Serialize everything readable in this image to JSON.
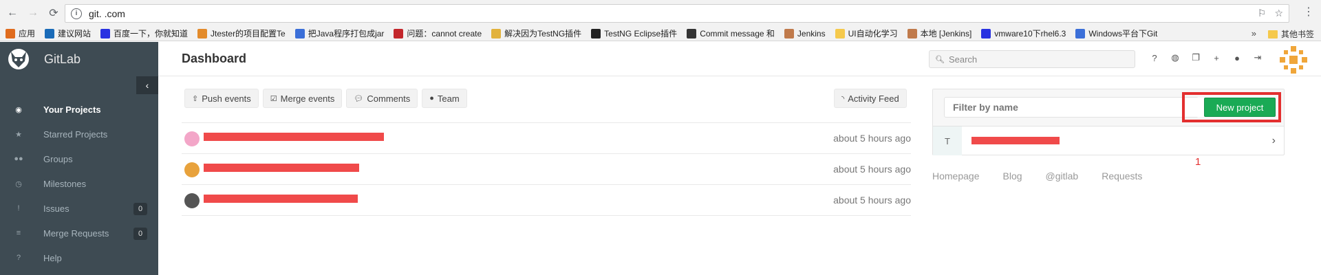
{
  "browser": {
    "url": "git.                    .com",
    "back_icon": "back-arrow-icon",
    "forward_icon": "forward-arrow-icon",
    "reload_icon": "reload-icon",
    "bookmarks": [
      {
        "label": "应用",
        "icon": "apps-grid-icon",
        "color": "#e06c1e"
      },
      {
        "label": "建议网站",
        "icon": "b-icon",
        "color": "#1a6bb8"
      },
      {
        "label": "百度一下，你就知道",
        "icon": "baidu-paw-icon",
        "color": "#2932e1"
      },
      {
        "label": "Jtester的项目配置Te",
        "icon": "page-icon",
        "color": "#e38b2b"
      },
      {
        "label": "把Java程序打包成jar",
        "icon": "globe-icon",
        "color": "#3b6fd8"
      },
      {
        "label": "问题：cannot create",
        "icon": "c-icon",
        "color": "#c3262b"
      },
      {
        "label": "解决因为TestNG插件",
        "icon": "helmet-icon",
        "color": "#e2b23c"
      },
      {
        "label": "TestNG Eclipse插件",
        "icon": "b-icon",
        "color": "#222222"
      },
      {
        "label": "Commit message 和",
        "icon": "logo-icon",
        "color": "#333333"
      },
      {
        "label": "Jenkins",
        "icon": "jenkins-icon",
        "color": "#c07a4b"
      },
      {
        "label": "UI自动化学习",
        "icon": "folder-icon",
        "color": "#f5c94c"
      },
      {
        "label": "本地 [Jenkins]",
        "icon": "jenkins-icon",
        "color": "#c07a4b"
      },
      {
        "label": "vmware10下rhel6.3",
        "icon": "baidu-paw-icon",
        "color": "#2932e1"
      },
      {
        "label": "Windows平台下Git",
        "icon": "globe-icon",
        "color": "#3b6fd8"
      }
    ],
    "more_label": "»",
    "other_bookmarks": "其他书签"
  },
  "sidebar": {
    "brand": "GitLab",
    "collapse_icon": "‹",
    "items": [
      {
        "label": "Your Projects",
        "icon": "dashboard-icon",
        "glyph": "◉",
        "active": true
      },
      {
        "label": "Starred Projects",
        "icon": "star-icon",
        "glyph": "★"
      },
      {
        "label": "Groups",
        "icon": "group-icon",
        "glyph": "●●"
      },
      {
        "label": "Milestones",
        "icon": "clock-icon",
        "glyph": "◷"
      },
      {
        "label": "Issues",
        "icon": "exclamation-icon",
        "glyph": "!",
        "count": "0"
      },
      {
        "label": "Merge Requests",
        "icon": "list-icon",
        "glyph": "≡",
        "count": "0"
      },
      {
        "label": "Help",
        "icon": "question-icon",
        "glyph": "?"
      }
    ]
  },
  "header": {
    "title": "Dashboard",
    "search_placeholder": "Search",
    "icons": [
      "help-icon",
      "globe-icon",
      "copy-icon",
      "plus-icon",
      "user-icon",
      "signout-icon"
    ]
  },
  "filters": {
    "push": "Push events",
    "merge": "Merge events",
    "comments": "Comments",
    "team": "Team",
    "feed": "Activity Feed"
  },
  "events": [
    {
      "time": "about 5 hours ago",
      "avatar_color": "#f3a6c8"
    },
    {
      "time": "about 5 hours ago",
      "avatar_color": "#e8a23c"
    },
    {
      "time": "about 5 hours ago",
      "avatar_color": "#555555"
    }
  ],
  "projects": {
    "filter_placeholder": "Filter by name",
    "new_button": "New project",
    "rows": [
      {
        "letter": "T"
      }
    ],
    "callout": "1"
  },
  "footer_links": [
    "Homepage",
    "Blog",
    "@gitlab",
    "Requests"
  ],
  "colors": {
    "sidebar": "#3e4b53",
    "new_button": "#1aaa55",
    "highlight": "#e32f2f"
  }
}
